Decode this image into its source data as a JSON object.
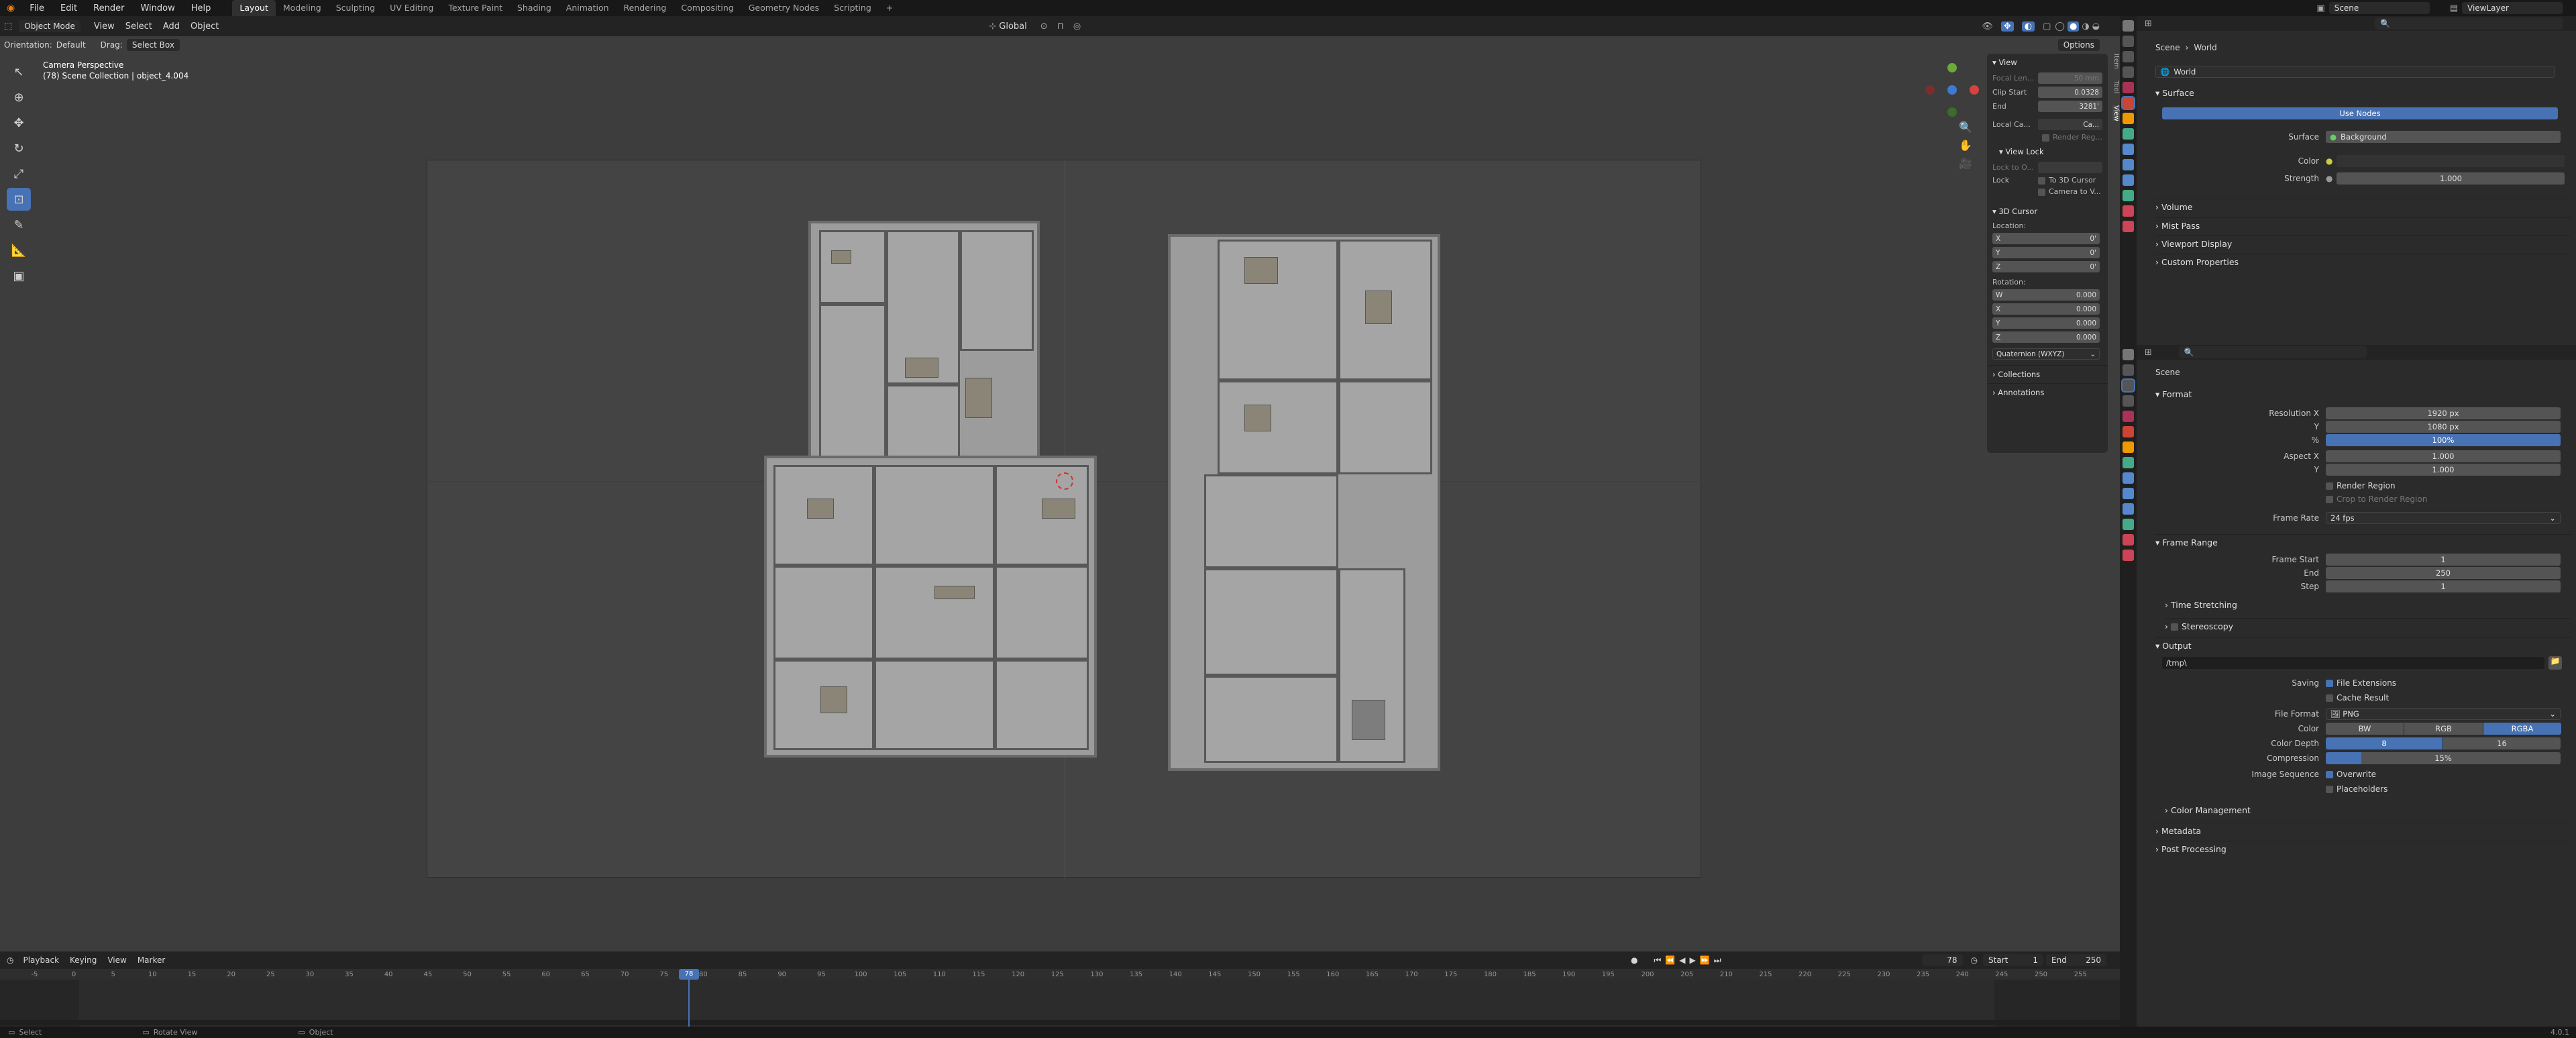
{
  "topbar": {
    "menus": [
      "File",
      "Edit",
      "Render",
      "Window",
      "Help"
    ],
    "workspaces": [
      "Layout",
      "Modeling",
      "Sculpting",
      "UV Editing",
      "Texture Paint",
      "Shading",
      "Animation",
      "Rendering",
      "Compositing",
      "Geometry Nodes",
      "Scripting"
    ],
    "active_workspace": "Layout",
    "add_tab": "+",
    "scene": "Scene",
    "view_layer": "ViewLayer"
  },
  "viewport_header": {
    "mode": "Object Mode",
    "menus": [
      "View",
      "Select",
      "Add",
      "Object"
    ],
    "transform_space": "Global",
    "orientation_label": "Orientation:",
    "orientation_value": "Default",
    "drag_label": "Drag:",
    "drag_value": "Select Box",
    "options": "Options"
  },
  "viewport": {
    "title": "Camera Perspective",
    "subtitle": "(78) Scene Collection | object_4.004"
  },
  "npanel": {
    "tabs": [
      "Item",
      "Tool",
      "View"
    ],
    "view_section": "View",
    "focal_label": "Focal Len...",
    "focal_value": "50 mm",
    "clip_start_label": "Clip Start",
    "clip_start_value": "0.0328",
    "clip_end_label": "End",
    "clip_end_value": "3281'",
    "local_camera_label": "Local Ca...",
    "local_camera_value": "Ca...",
    "render_region": "Render Reg...",
    "view_lock_section": "View Lock",
    "lock_to_label": "Lock to O...",
    "lock_label": "Lock",
    "lock_to_cursor": "To 3D Cursor",
    "lock_camera": "Camera to V...",
    "cursor_section": "3D Cursor",
    "location_label": "Location:",
    "loc": [
      {
        "axis": "X",
        "value": "0'"
      },
      {
        "axis": "Y",
        "value": "0'"
      },
      {
        "axis": "Z",
        "value": "0'"
      }
    ],
    "rotation_label": "Rotation:",
    "rot": [
      {
        "axis": "W",
        "value": "0.000"
      },
      {
        "axis": "X",
        "value": "0.000"
      },
      {
        "axis": "Y",
        "value": "0.000"
      },
      {
        "axis": "Z",
        "value": "0.000"
      }
    ],
    "rotation_mode": "Quaternion (WXYZ)",
    "collections": "Collections",
    "annotations": "Annotations"
  },
  "world_props": {
    "breadcrumb_scene": "Scene",
    "breadcrumb_world": "World",
    "world_name": "World",
    "surface_section": "Surface",
    "use_nodes": "Use Nodes",
    "surface_label": "Surface",
    "surface_value": "Background",
    "color_label": "Color",
    "strength_label": "Strength",
    "strength_value": "1.000",
    "volume": "Volume",
    "mist_pass": "Mist Pass",
    "viewport_display": "Viewport Display",
    "custom_properties": "Custom Properties"
  },
  "output_props": {
    "breadcrumb_scene": "Scene",
    "format_section": "Format",
    "res_x_label": "Resolution X",
    "res_x_value": "1920 px",
    "res_y_label": "Y",
    "res_y_value": "1080 px",
    "res_pct_label": "%",
    "res_pct_value": "100%",
    "aspect_x_label": "Aspect X",
    "aspect_x_value": "1.000",
    "aspect_y_label": "Y",
    "aspect_y_value": "1.000",
    "render_region": "Render Region",
    "crop_region": "Crop to Render Region",
    "frame_rate_label": "Frame Rate",
    "frame_rate_value": "24 fps",
    "frame_range_section": "Frame Range",
    "frame_start_label": "Frame Start",
    "frame_start_value": "1",
    "end_label": "End",
    "end_value": "250",
    "step_label": "Step",
    "step_value": "1",
    "time_stretching": "Time Stretching",
    "stereoscopy": "Stereoscopy",
    "output_section": "Output",
    "output_path": "/tmp\\",
    "saving_label": "Saving",
    "file_extensions": "File Extensions",
    "cache_result": "Cache Result",
    "file_format_label": "File Format",
    "file_format_value": "PNG",
    "color_label": "Color",
    "color_options": [
      "BW",
      "RGB",
      "RGBA"
    ],
    "color_selected": "RGBA",
    "color_depth_label": "Color Depth",
    "depth_options": [
      "8",
      "16"
    ],
    "depth_selected": "8",
    "compression_label": "Compression",
    "compression_value": "15%",
    "compression_fraction": 0.15,
    "image_sequence_label": "Image Sequence",
    "overwrite": "Overwrite",
    "placeholders": "Placeholders",
    "color_management": "Color Management",
    "metadata": "Metadata",
    "post_processing": "Post Processing"
  },
  "timeline": {
    "menus": [
      "Playback",
      "Keying",
      "View",
      "Marker"
    ],
    "current_frame": "78",
    "start_label": "Start",
    "start_value": "1",
    "end_label": "End",
    "end_value": "250",
    "ticks": [
      "-5",
      "0",
      "5",
      "10",
      "15",
      "20",
      "25",
      "30",
      "35",
      "40",
      "45",
      "50",
      "55",
      "60",
      "65",
      "70",
      "75",
      "78",
      "80",
      "85",
      "90",
      "95",
      "100",
      "105",
      "110",
      "115",
      "120",
      "125",
      "130",
      "135",
      "140",
      "145",
      "150",
      "155",
      "160",
      "165",
      "170",
      "175",
      "180",
      "185",
      "190",
      "195",
      "200",
      "205",
      "210",
      "215",
      "220",
      "225",
      "230",
      "235",
      "240",
      "245",
      "250",
      "255"
    ]
  },
  "statusbar": {
    "select": "Select",
    "rotate_view": "Rotate View",
    "object": "Object",
    "version": "4.0.1"
  },
  "colors": {
    "accent": "#4772b3",
    "panel": "#2b2b2b",
    "viewport": "#3d3d3d"
  }
}
